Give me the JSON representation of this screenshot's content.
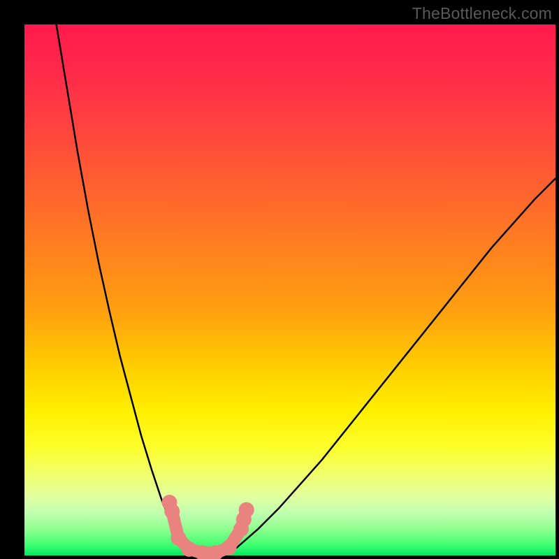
{
  "watermark": "TheBottleneck.com",
  "chart_data": {
    "type": "line",
    "title": "",
    "xlabel": "",
    "ylabel": "",
    "xlim": [
      0,
      100
    ],
    "ylim": [
      0,
      100
    ],
    "background_gradient": {
      "top": "#ff1a4d",
      "upper_mid": "#ffa010",
      "mid": "#fff000",
      "lower_mid": "#c0ffb0",
      "bottom": "#00e860",
      "meaning": "red = high bottleneck, green = low bottleneck"
    },
    "series": [
      {
        "name": "left-curve",
        "x": [
          6,
          8,
          10,
          12,
          14,
          16,
          18,
          20,
          22,
          24,
          26,
          28,
          30,
          32
        ],
        "y": [
          100,
          88,
          76,
          65,
          55,
          46,
          37.5,
          30,
          22.5,
          16,
          10,
          5.5,
          2.2,
          0.3
        ]
      },
      {
        "name": "right-curve",
        "x": [
          38,
          40,
          44,
          48,
          52,
          56,
          60,
          64,
          68,
          72,
          76,
          80,
          84,
          88,
          92,
          96,
          100
        ],
        "y": [
          0.3,
          1.5,
          5,
          9,
          13.5,
          18,
          23,
          28,
          33,
          38,
          43,
          48,
          53,
          58,
          62.5,
          67,
          71
        ]
      },
      {
        "name": "marker-band",
        "color": "#e8837f",
        "type": "overlay",
        "points": [
          {
            "x": 27.3,
            "y": 10.0
          },
          {
            "x": 27.8,
            "y": 8.3
          },
          {
            "x": 29.0,
            "y": 3.3
          },
          {
            "x": 31.0,
            "y": 1.2
          },
          {
            "x": 33.5,
            "y": 0.5
          },
          {
            "x": 36.0,
            "y": 0.5
          },
          {
            "x": 38.5,
            "y": 1.5
          },
          {
            "x": 40.8,
            "y": 5.0
          },
          {
            "x": 41.3,
            "y": 6.8
          },
          {
            "x": 41.8,
            "y": 8.6
          }
        ]
      }
    ],
    "annotations": []
  }
}
